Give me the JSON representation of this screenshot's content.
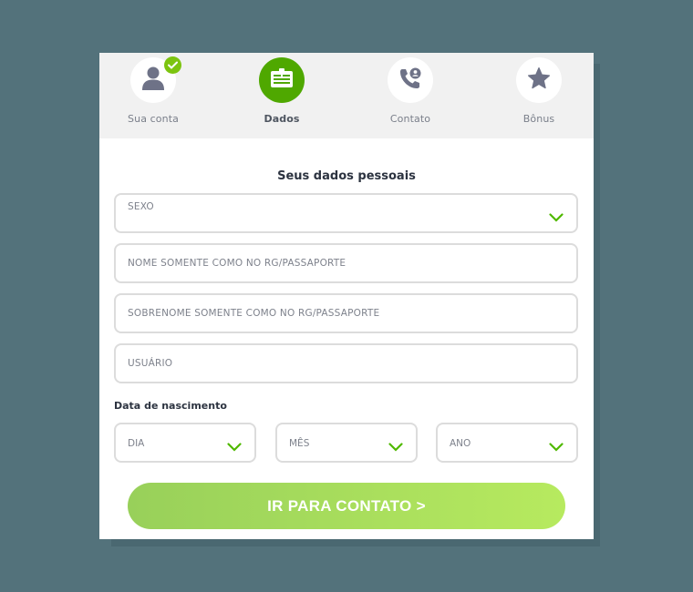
{
  "steps": [
    {
      "label": "Sua conta",
      "icon": "user-icon",
      "state": "done"
    },
    {
      "label": "Dados",
      "icon": "id-card-icon",
      "state": "active"
    },
    {
      "label": "Contato",
      "icon": "phone-icon",
      "state": "pending"
    },
    {
      "label": "Bônus",
      "icon": "star-icon",
      "state": "pending"
    }
  ],
  "form": {
    "title": "Seus dados pessoais",
    "sexo_placeholder": "SEXO",
    "nome_placeholder": "NOME SOMENTE COMO NO RG/PASSAPORTE",
    "sobrenome_placeholder": "SOBRENOME SOMENTE COMO NO RG/PASSAPORTE",
    "usuario_placeholder": "USUÁRIO",
    "birth_label": "Data de nascimento",
    "dia_placeholder": "DIA",
    "mes_placeholder": "MÊS",
    "ano_placeholder": "ANO",
    "submit_label": "IR PARA CONTATO >"
  },
  "colors": {
    "accent": "#4fa800",
    "check": "#7cc40f",
    "chevron": "#4fb800",
    "button_start": "#98d05a",
    "button_end": "#b7ea5f",
    "background": "#53727b"
  }
}
